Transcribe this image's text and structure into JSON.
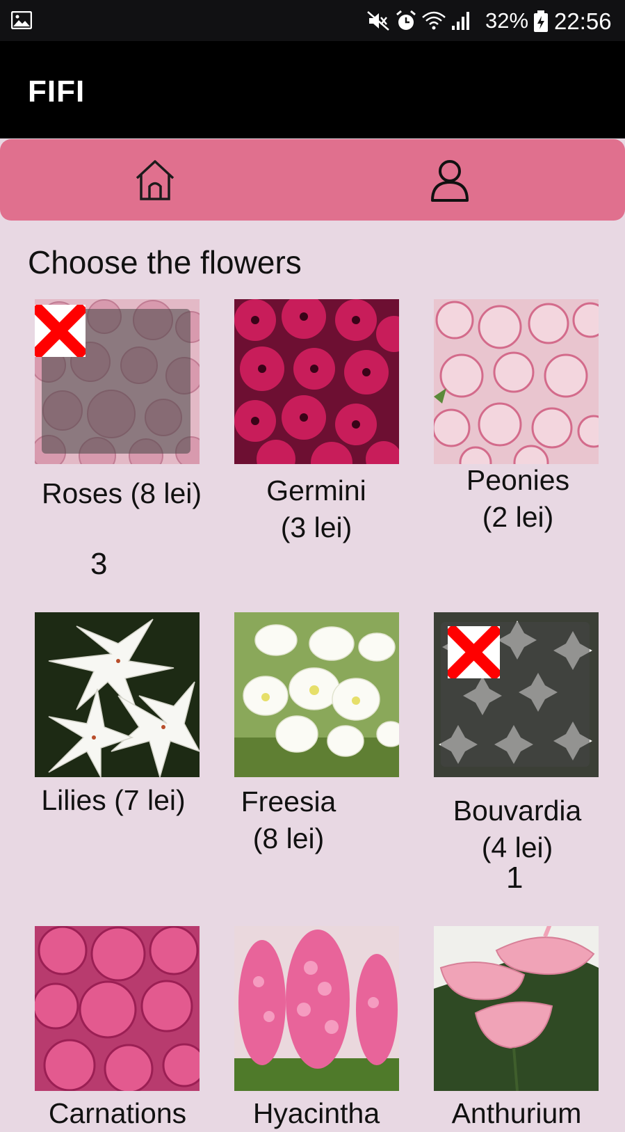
{
  "status_bar": {
    "battery_percent": "32%",
    "time": "22:56",
    "icons": [
      "image-icon",
      "mute-icon",
      "alarm-icon",
      "wifi-icon",
      "signal-icon",
      "battery-icon"
    ]
  },
  "app_bar": {
    "title": "FIFI"
  },
  "nav": {
    "items": [
      {
        "name": "home",
        "icon": "home-icon"
      },
      {
        "name": "profile",
        "icon": "person-icon"
      }
    ],
    "color": "#e0708e"
  },
  "main": {
    "title": "Choose the flowers",
    "flowers": [
      {
        "label": "Roses (8 lei)",
        "count": "3",
        "removable": true
      },
      {
        "label": "Germini\n(3 lei)"
      },
      {
        "label": "Peonies\n(2 lei)"
      },
      {
        "label": "Lilies (7 lei)"
      },
      {
        "label": "Freesia\n(8 lei)"
      },
      {
        "label": "Bouvardia\n(4 lei)",
        "count": "1",
        "removable": true
      },
      {
        "label": "Carnations"
      },
      {
        "label": "Hyacintha"
      },
      {
        "label": "Anthurium"
      }
    ]
  },
  "colors": {
    "background": "#e8d8e3",
    "app_bar": "#000000",
    "remove_badge": "#ff0000"
  }
}
